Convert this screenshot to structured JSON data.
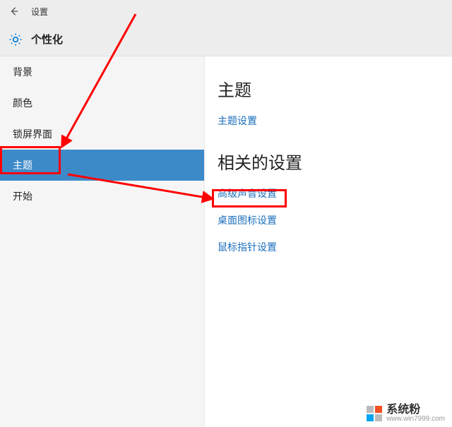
{
  "titlebar": {
    "title": "设置"
  },
  "header": {
    "title": "个性化"
  },
  "sidebar": {
    "items": [
      {
        "label": "背景"
      },
      {
        "label": "颜色"
      },
      {
        "label": "锁屏界面"
      },
      {
        "label": "主题",
        "selected": true
      },
      {
        "label": "开始"
      }
    ]
  },
  "content": {
    "section1": {
      "title": "主题",
      "links": [
        {
          "label": "主题设置"
        }
      ]
    },
    "section2": {
      "title": "相关的设置",
      "links": [
        {
          "label": "高级声音设置"
        },
        {
          "label": "桌面图标设置"
        },
        {
          "label": "鼠标指针设置"
        }
      ]
    }
  },
  "watermark": {
    "brand": "系统粉",
    "url": "www.win7999.com"
  }
}
